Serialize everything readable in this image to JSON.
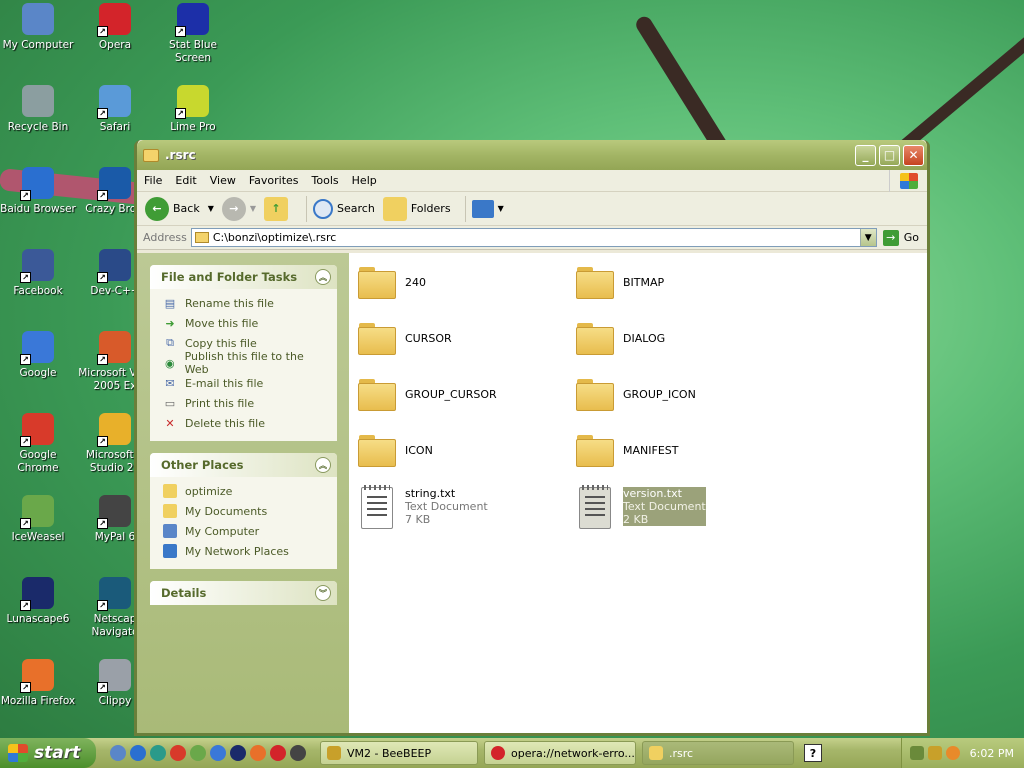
{
  "desktop": {
    "icons": [
      {
        "label": "My Computer",
        "icon": "computer-icon",
        "color": "#5a86c8"
      },
      {
        "label": "Opera",
        "icon": "opera-icon",
        "color": "#d3242a"
      },
      {
        "label": "Stat Blue Screen",
        "icon": "bluescreen-icon",
        "color": "#1c2fa8"
      },
      {
        "label": "Recycle Bin",
        "icon": "recycle-bin-icon",
        "color": "#8b9ea0"
      },
      {
        "label": "Safari",
        "icon": "safari-icon",
        "color": "#5a9ad8"
      },
      {
        "label": "Lime Pro",
        "icon": "lime-icon",
        "color": "#c8d82e"
      },
      {
        "label": "Baidu Browser",
        "icon": "baidu-icon",
        "color": "#2a6fd0"
      },
      {
        "label": "Crazy Brow",
        "icon": "crazy-browser-icon",
        "color": "#1a5aa8"
      },
      {
        "label": "Facebook",
        "icon": "facebook-icon",
        "color": "#3b5998"
      },
      {
        "label": "Dev-C++",
        "icon": "devcpp-icon",
        "color": "#2a4a88"
      },
      {
        "label": "Google",
        "icon": "google-icon",
        "color": "#3a78d8"
      },
      {
        "label": "Microsoft V J# 2005 Ex",
        "icon": "vjsharp-icon",
        "color": "#d85a2a"
      },
      {
        "label": "Google Chrome",
        "icon": "chrome-icon",
        "color": "#d83a2a"
      },
      {
        "label": "Microsoft V Studio 20",
        "icon": "visual-studio-icon",
        "color": "#e8b02a"
      },
      {
        "label": "IceWeasel",
        "icon": "iceweasel-icon",
        "color": "#6aa84a"
      },
      {
        "label": "MyPal 6",
        "icon": "mypal-icon",
        "color": "#444444"
      },
      {
        "label": "Lunascape6",
        "icon": "lunascape-icon",
        "color": "#1a2a6a"
      },
      {
        "label": "Netscap Navigato",
        "icon": "netscape-icon",
        "color": "#1a5a7a"
      },
      {
        "label": "Mozilla Firefox",
        "icon": "firefox-icon",
        "color": "#e8702a"
      },
      {
        "label": "Clippy",
        "icon": "clippy-icon",
        "color": "#9aa0a8"
      }
    ]
  },
  "window": {
    "title": ".rsrc",
    "menu": [
      "File",
      "Edit",
      "View",
      "Favorites",
      "Tools",
      "Help"
    ],
    "toolbar": {
      "back": "Back",
      "search": "Search",
      "folders": "Folders"
    },
    "address": {
      "label": "Address",
      "value": "C:\\bonzi\\optimize\\.rsrc",
      "go": "Go"
    },
    "tasks": {
      "title": "File and Folder Tasks",
      "items": [
        "Rename this file",
        "Move this file",
        "Copy this file",
        "Publish this file to the Web",
        "E-mail this file",
        "Print this file",
        "Delete this file"
      ]
    },
    "places": {
      "title": "Other Places",
      "items": [
        "optimize",
        "My Documents",
        "My Computer",
        "My Network Places"
      ]
    },
    "details": {
      "title": "Details"
    },
    "folders": [
      "240",
      "BITMAP",
      "CURSOR",
      "DIALOG",
      "GROUP_CURSOR",
      "GROUP_ICON",
      "ICON",
      "MANIFEST"
    ],
    "files": [
      {
        "name": "string.txt",
        "type": "Text Document",
        "size": "7 KB"
      },
      {
        "name": "version.txt",
        "type": "Text Document",
        "size": "2 KB"
      }
    ]
  },
  "taskbar": {
    "start": "start",
    "tasks": [
      "VM2 - BeeBEEP",
      "opera://network-erro...",
      ".rsrc"
    ],
    "clock": "6:02 PM"
  }
}
